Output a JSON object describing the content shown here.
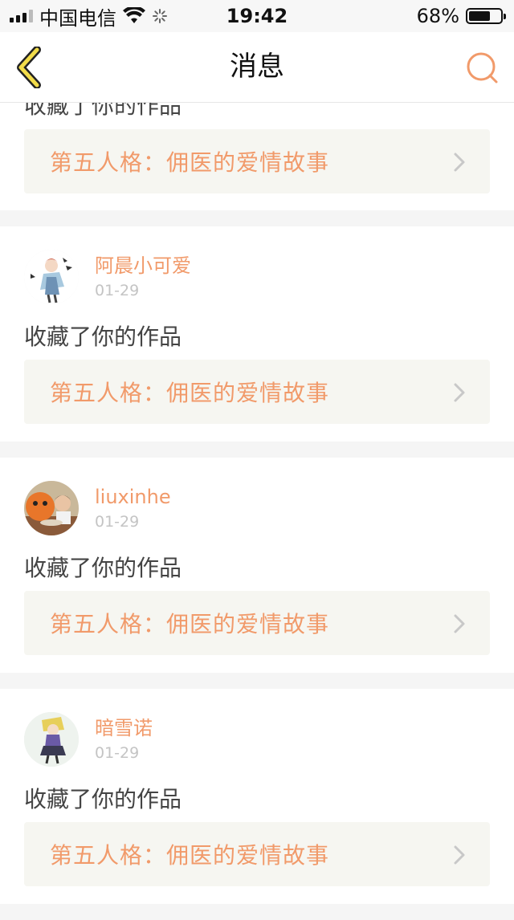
{
  "status_bar": {
    "carrier": "中国电信",
    "time": "19:42",
    "battery": "68%",
    "battery_level": 0.68
  },
  "nav": {
    "title": "消息",
    "back_icon": "chevron-left-icon",
    "search_icon": "search-icon"
  },
  "partial_item": {
    "action": "收藏了你的作品",
    "work_title": "第五人格：佣医的爱情故事"
  },
  "items": [
    {
      "username": "阿晨小可爱",
      "date": "01-29",
      "action": "收藏了你的作品",
      "work_title": "第五人格：佣医的爱情故事"
    },
    {
      "username": "liuxinhe",
      "date": "01-29",
      "action": "收藏了你的作品",
      "work_title": "第五人格：佣医的爱情故事"
    },
    {
      "username": "暗雪诺",
      "date": "01-29",
      "action": "收藏了你的作品",
      "work_title": "第五人格：佣医的爱情故事"
    }
  ],
  "colors": {
    "accent": "#f19a6a",
    "back_icon_fill": "#f2dc4a"
  }
}
